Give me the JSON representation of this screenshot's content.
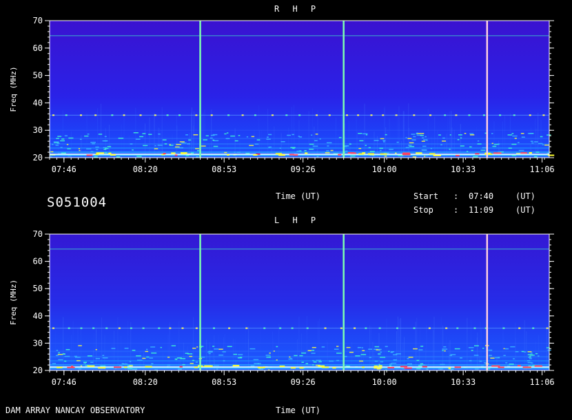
{
  "chart_data": [
    {
      "type": "heatmap",
      "title": "R H P",
      "ylabel": "Freq (MHz)",
      "xlabel": "Time (UT)",
      "yticks": [
        "20",
        "30",
        "40",
        "50",
        "60",
        "70"
      ],
      "ylim": [
        20,
        70
      ],
      "xticks": [
        "07:46",
        "08:20",
        "08:53",
        "09:26",
        "10:00",
        "10:33",
        "11:06"
      ],
      "xlim": [
        "07:40",
        "11:09"
      ],
      "markers": [
        "08:43",
        "09:43",
        "10:43"
      ],
      "colors": {
        "background": "#3316d8",
        "low": "#1a30ff",
        "high": "#ffff00",
        "marker": "#7dffb0"
      }
    },
    {
      "type": "heatmap",
      "title": "L H P",
      "ylabel": "Freq (MHz)",
      "xlabel": "Time (UT)",
      "yticks": [
        "20",
        "30",
        "40",
        "50",
        "60",
        "70"
      ],
      "ylim": [
        20,
        70
      ],
      "xticks": [
        "07:46",
        "08:20",
        "08:53",
        "09:26",
        "10:00",
        "10:33",
        "11:06"
      ],
      "xlim": [
        "07:40",
        "11:09"
      ],
      "markers": [
        "08:43",
        "09:43",
        "10:43"
      ],
      "colors": {
        "background": "#2c1fdf",
        "low": "#1a30ff",
        "high": "#ffff00",
        "marker": "#7dffb0"
      }
    }
  ],
  "header": {
    "observation_id": "S051004",
    "time_axis_label": "Time (UT)",
    "start_label": "Start",
    "start_sep": ":",
    "start_value": "07:40",
    "start_unit": "(UT)",
    "stop_label": "Stop",
    "stop_sep": ":",
    "stop_value": "11:09",
    "stop_unit": "(UT)"
  },
  "footer": {
    "instrument": "DAM ARRAY   NANCAY OBSERVATORY",
    "time_axis_label": "Time (UT)"
  }
}
